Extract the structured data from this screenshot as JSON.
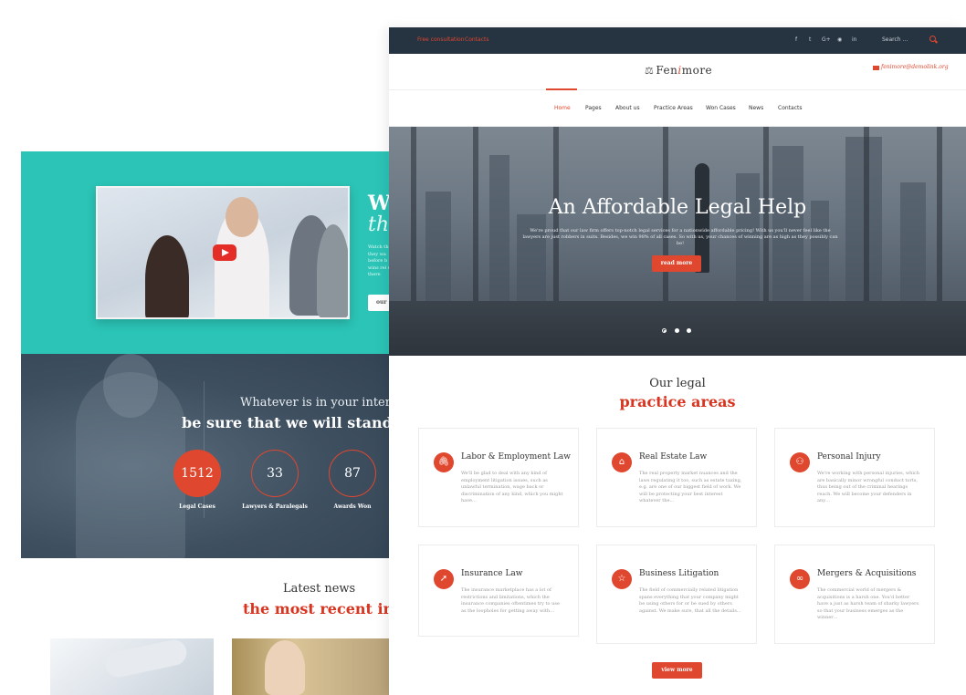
{
  "back_page": {
    "video_section": {
      "heading": "W",
      "subheading": "th",
      "paragraph": "Watch th they wa before b wins rel us, there",
      "button_label": "our"
    },
    "stats_section": {
      "line1": "Whatever is in your interest",
      "line2": "be sure that we will stand by i",
      "counters": [
        {
          "value": "1512",
          "label": "Legal Cases"
        },
        {
          "value": "33",
          "label": "Lawyers & Paralegals"
        },
        {
          "value": "87",
          "label": "Awards Won"
        }
      ]
    },
    "news_section": {
      "title": "Latest news",
      "subtitle": "the most recent info"
    }
  },
  "front_page": {
    "topbar": {
      "links": [
        "Free consultation",
        "Contacts"
      ],
      "social": [
        "f",
        "t",
        "G+",
        "◉",
        "in"
      ],
      "search_placeholder": "Search ..."
    },
    "header": {
      "logo_part1": "Fen",
      "logo_part2": "i",
      "logo_part3": "more",
      "email": "fenimore@demolink.org"
    },
    "nav": {
      "items": [
        "Home",
        "Pages",
        "About us",
        "Practice Areas",
        "Won Cases",
        "News",
        "Contacts"
      ],
      "active": "Home"
    },
    "hero": {
      "title": "An Affordable Legal Help",
      "text": "We're proud that our law firm offers top-notch legal services for a nationwide affordable pricing! With us you'll never feel like the lawyers are just robbers in suits. Besides, we win 98% of all cases. So with us, your chances of winning are as high as they possibly can be!",
      "button_label": "read more",
      "slides": 3,
      "active_slide": 1
    },
    "practice": {
      "title": "Our legal",
      "subtitle": "practice areas",
      "cards": [
        {
          "icon": "paperclip-icon",
          "glyph": "🖇",
          "title": "Labor & Employment Law",
          "text": "We'll be glad to deal with any kind of employment litigation issues, such as unlawful termination, wage back or discrimination of any kind, which you might have…"
        },
        {
          "icon": "house-icon",
          "glyph": "⌂",
          "title": "Real Estate Law",
          "text": "The real property market nuances and the laws regulating it too, such as estate taxing, e.g. are one of our biggest field of work. We will be protecting your best interest whatever the…"
        },
        {
          "icon": "people-icon",
          "glyph": "⚇",
          "title": "Personal Injury",
          "text": "We're working with personal injuries, which are basically minor wrongful conduct torts, thus being out of the criminal hearings reach. We will become your defenders in any…"
        },
        {
          "icon": "compass-icon",
          "glyph": "➚",
          "title": "Insurance Law",
          "text": "The insurance marketplace has a lot of restrictions and limitations, which the insurance companies oftentimes try to use as the loopholes for getting away with…"
        },
        {
          "icon": "star-icon",
          "glyph": "☆",
          "title": "Business Litigation",
          "text": "The field of commercially related litigation spans everything that your company might be using others for or be sued by others against. We make sure, that all the details…"
        },
        {
          "icon": "link-icon",
          "glyph": "∞",
          "title": "Mergers & Acquisitions",
          "text": "The commercial world of mergers & acquisitions is a harsh one. You'd better have a just as harsh team of sharky lawyers so that your business emerges as the winner…"
        }
      ],
      "view_more_label": "view more"
    }
  }
}
